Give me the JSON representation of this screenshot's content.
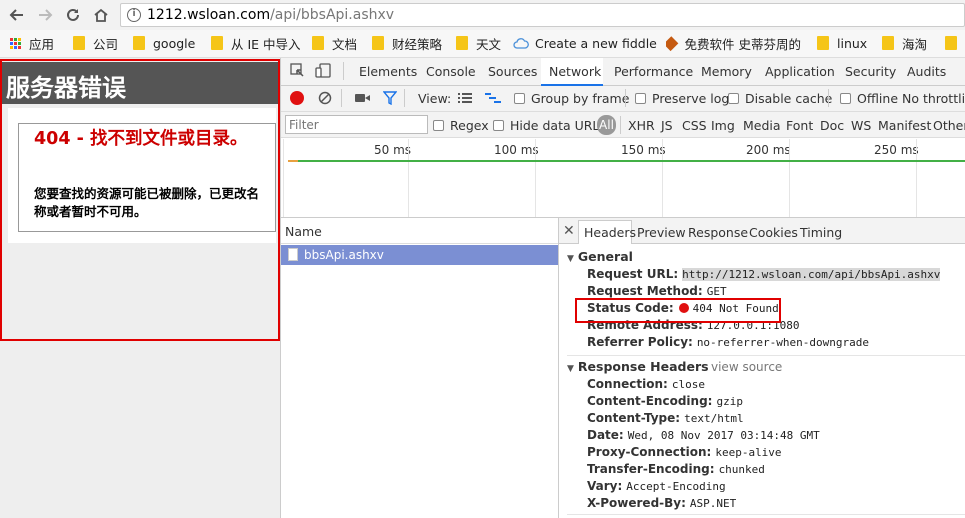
{
  "browser": {
    "url_host": "1212.wsloan.com",
    "url_path": "/api/bbsApi.ashxv",
    "bookmarks": [
      "应用",
      "公司",
      "google",
      "从 IE 中导入",
      "文档",
      "财经策略",
      "天文",
      "Create a new fiddle",
      "免费软件 史蒂芬周的",
      "linux",
      "海淘"
    ]
  },
  "page": {
    "header": "服务器错误",
    "error_title": "404 - 找不到文件或目录。",
    "error_desc": "您要查找的资源可能已被删除，已更改名称或者暂时不可用。"
  },
  "devtools": {
    "tabs": [
      "Elements",
      "Console",
      "Sources",
      "Network",
      "Performance",
      "Memory",
      "Application",
      "Security",
      "Audits"
    ],
    "active_tab": "Network",
    "toolbar": {
      "view_label": "View:",
      "group_by_frame": "Group by frame",
      "preserve_log": "Preserve log",
      "disable_cache": "Disable cache",
      "offline": "Offline",
      "throttling": "No throttling"
    },
    "filter": {
      "placeholder": "Filter",
      "regex": "Regex",
      "hide_data_urls": "Hide data URLs",
      "types": [
        "All",
        "XHR",
        "JS",
        "CSS",
        "Img",
        "Media",
        "Font",
        "Doc",
        "WS",
        "Manifest",
        "Other"
      ]
    },
    "timeline_ticks": [
      "50 ms",
      "100 ms",
      "150 ms",
      "200 ms",
      "250 ms"
    ],
    "name_header": "Name",
    "request_name": "bbsApi.ashxv",
    "panel_tabs": [
      "Headers",
      "Preview",
      "Response",
      "Cookies",
      "Timing"
    ],
    "general": {
      "title": "General",
      "rows": [
        {
          "k": "Request URL:",
          "v": "http://1212.wsloan.com/api/bbsApi.ashxv"
        },
        {
          "k": "Request Method:",
          "v": "GET"
        },
        {
          "k": "Status Code:",
          "v": "404 Not Found"
        },
        {
          "k": "Remote Address:",
          "v": "127.0.0.1:1080"
        },
        {
          "k": "Referrer Policy:",
          "v": "no-referrer-when-downgrade"
        }
      ]
    },
    "response_headers": {
      "title": "Response Headers",
      "view_source": "view source",
      "rows": [
        {
          "k": "Connection:",
          "v": "close"
        },
        {
          "k": "Content-Encoding:",
          "v": "gzip"
        },
        {
          "k": "Content-Type:",
          "v": "text/html"
        },
        {
          "k": "Date:",
          "v": "Wed, 08 Nov 2017 03:14:48 GMT"
        },
        {
          "k": "Proxy-Connection:",
          "v": "keep-alive"
        },
        {
          "k": "Transfer-Encoding:",
          "v": "chunked"
        },
        {
          "k": "Vary:",
          "v": "Accept-Encoding"
        },
        {
          "k": "X-Powered-By:",
          "v": "ASP.NET"
        }
      ]
    }
  },
  "colors": {
    "accent": "#1a73e8",
    "error_red": "#cc0000",
    "status_red": "#e01010",
    "highlight_box": "#e00000",
    "selected_row": "#7b8fd3"
  }
}
